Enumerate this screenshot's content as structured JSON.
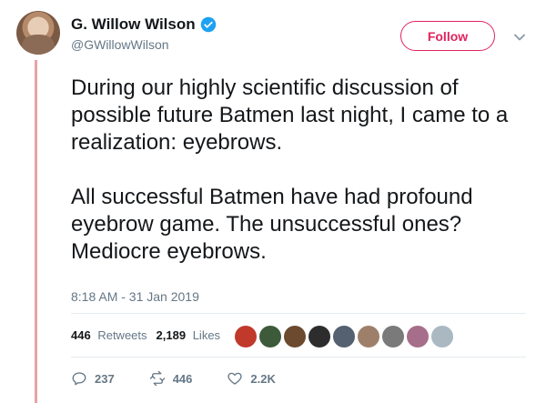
{
  "author": {
    "display_name": "G. Willow Wilson",
    "handle": "@GWillowWilson",
    "verified": true
  },
  "follow_button": {
    "label": "Follow"
  },
  "tweet": {
    "paragraphs": [
      "During our highly scientific discussion of possible future Batmen last night, I came to a realization: eyebrows.",
      "All successful Batmen have had profound eyebrow game. The unsuccessful ones? Mediocre eyebrows."
    ],
    "timestamp": "8:18 AM - 31 Jan 2019"
  },
  "stats": {
    "retweets_count": "446",
    "retweets_label": "Retweets",
    "likes_count": "2,189",
    "likes_label": "Likes"
  },
  "liker_avatars": [
    {
      "color": "#c0392b"
    },
    {
      "color": "#3d5a3a"
    },
    {
      "color": "#6b4a2f"
    },
    {
      "color": "#2d2d2d"
    },
    {
      "color": "#556070"
    },
    {
      "color": "#9e7f6a"
    },
    {
      "color": "#7a7a7a"
    },
    {
      "color": "#a66e8a"
    },
    {
      "color": "#aab8c2"
    }
  ],
  "actions": {
    "reply_count": "237",
    "retweet_count": "446",
    "like_count": "2.2K"
  },
  "colors": {
    "accent": "#e0245e",
    "verified": "#1da1f2",
    "muted_text": "#657786",
    "thread_line": "#e8a3a3"
  }
}
